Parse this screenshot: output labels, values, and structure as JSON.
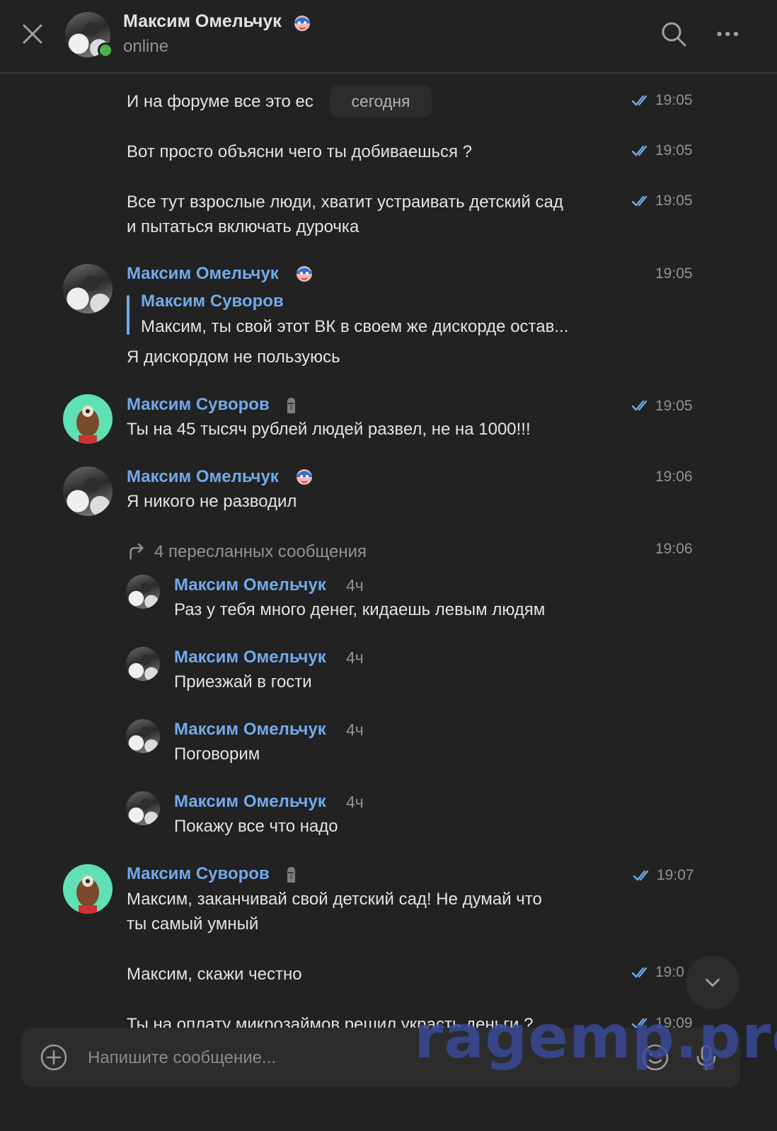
{
  "header": {
    "name": "Максим Омельчук",
    "status": "online",
    "close_icon": "close-icon",
    "search_icon": "search-icon",
    "more_icon": "more-icon"
  },
  "date_pill": "сегодня",
  "messages": [
    {
      "text": "И на форуме все это ес",
      "time": "19:05",
      "read": true
    },
    {
      "text": "Вот просто объясни чего ты добиваешься ?",
      "time": "19:05",
      "read": true
    },
    {
      "text_line1": "Все тут взрослые люди, хватит устраивать детский сад",
      "text_line2": "и пытаться включать дурочка",
      "time": "19:05",
      "read": true
    },
    {
      "author": "Максим Омельчук",
      "time": "19:05",
      "quote_author": "Максим Суворов",
      "quote_text": "Максим, ты свой этот ВК в своем же дискорде остав...",
      "text": "Я дискордом не пользуюсь"
    },
    {
      "author": "Максим Суворов",
      "time": "19:05",
      "read": true,
      "text": "Ты на 45 тысяч рублей людей развел, не на 1000!!!"
    },
    {
      "author": "Максим Омельчук",
      "time": "19:06",
      "text": "Я никого не разводил"
    },
    {
      "forward_header": "4 пересланных сообщения",
      "time": "19:06",
      "items": [
        {
          "author": "Максим Омельчук",
          "age": "4ч",
          "text": "Раз у тебя много денег, кидаешь левым людям"
        },
        {
          "author": "Максим Омельчук",
          "age": "4ч",
          "text": "Приезжай в гости"
        },
        {
          "author": "Максим Омельчук",
          "age": "4ч",
          "text": "Поговорим"
        },
        {
          "author": "Максим Омельчук",
          "age": "4ч",
          "text": "Покажу все что надо"
        }
      ]
    },
    {
      "author": "Максим Суворов",
      "time": "19:07",
      "read": true,
      "text_line1": "Максим, заканчивай свой детский сад! Не думай что",
      "text_line2": "ты самый умный"
    },
    {
      "text": "Максим, скажи честно",
      "time": "19:0",
      "read": true
    },
    {
      "text": "Ты на оплату микрозаймов решил украсть деньги ?",
      "time": "19:09",
      "read": true
    }
  ],
  "composer": {
    "placeholder": "Напишите сообщение...",
    "add_icon": "plus-circle-icon",
    "emoji_icon": "smile-icon",
    "mic_icon": "microphone-icon"
  },
  "watermark": "ragemp.pro",
  "colors": {
    "background": "#222222",
    "accent": "#71aaeb",
    "muted": "#939393",
    "text": "#e1e3e6"
  }
}
